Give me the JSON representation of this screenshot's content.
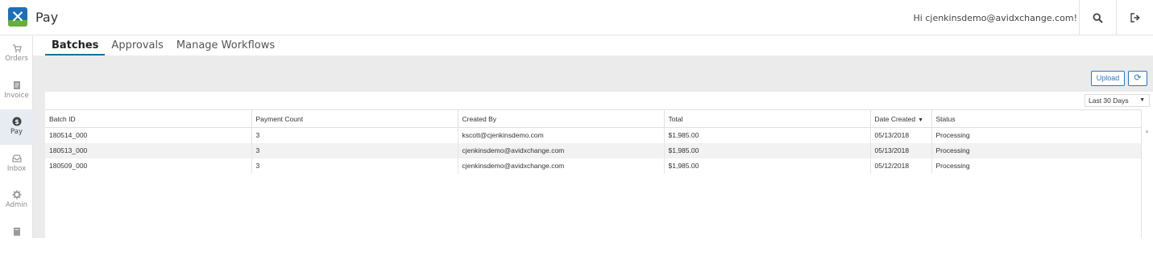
{
  "app": {
    "title": "Pay",
    "greeting": "Hi cjenkinsdemo@avidxchange.com!",
    "logo": "x-logo"
  },
  "colors": {
    "accent": "#2b78c2",
    "tab_underline": "#1b6f97",
    "background": "#ebebeb",
    "active_nav": "#e6ecf2"
  },
  "sidebar": {
    "items": [
      {
        "label": "Orders",
        "icon": "cart-icon"
      },
      {
        "label": "Invoice",
        "icon": "invoice-icon"
      },
      {
        "label": "Pay",
        "icon": "dollar-icon",
        "active": true
      },
      {
        "label": "Inbox",
        "icon": "inbox-icon"
      },
      {
        "label": "Admin",
        "icon": "gear-icon"
      },
      {
        "label": "",
        "icon": "reports-icon"
      }
    ]
  },
  "tabs": [
    {
      "label": "Batches",
      "active": true
    },
    {
      "label": "Approvals"
    },
    {
      "label": "Manage Workflows"
    }
  ],
  "toolbar": {
    "upload_label": "Upload",
    "refresh_icon": "refresh-icon"
  },
  "filter": {
    "range": "Last 30 Days"
  },
  "table": {
    "columns": [
      "Batch ID",
      "Payment Count",
      "Created By",
      "Total",
      "Date Created",
      "Status"
    ],
    "sort_column": "Date Created",
    "rows": [
      {
        "batch_id": "180514_000",
        "payment_count": "3",
        "created_by": "kscott@cjenkinsdemo.com",
        "total": "$1,985.00",
        "date_created": "05/13/2018",
        "status": "Processing"
      },
      {
        "batch_id": "180513_000",
        "payment_count": "3",
        "created_by": "cjenkinsdemo@avidxchange.com",
        "total": "$1,985.00",
        "date_created": "05/13/2018",
        "status": "Processing"
      },
      {
        "batch_id": "180509_000",
        "payment_count": "3",
        "created_by": "cjenkinsdemo@avidxchange.com",
        "total": "$1,985.00",
        "date_created": "05/12/2018",
        "status": "Processing"
      }
    ]
  }
}
